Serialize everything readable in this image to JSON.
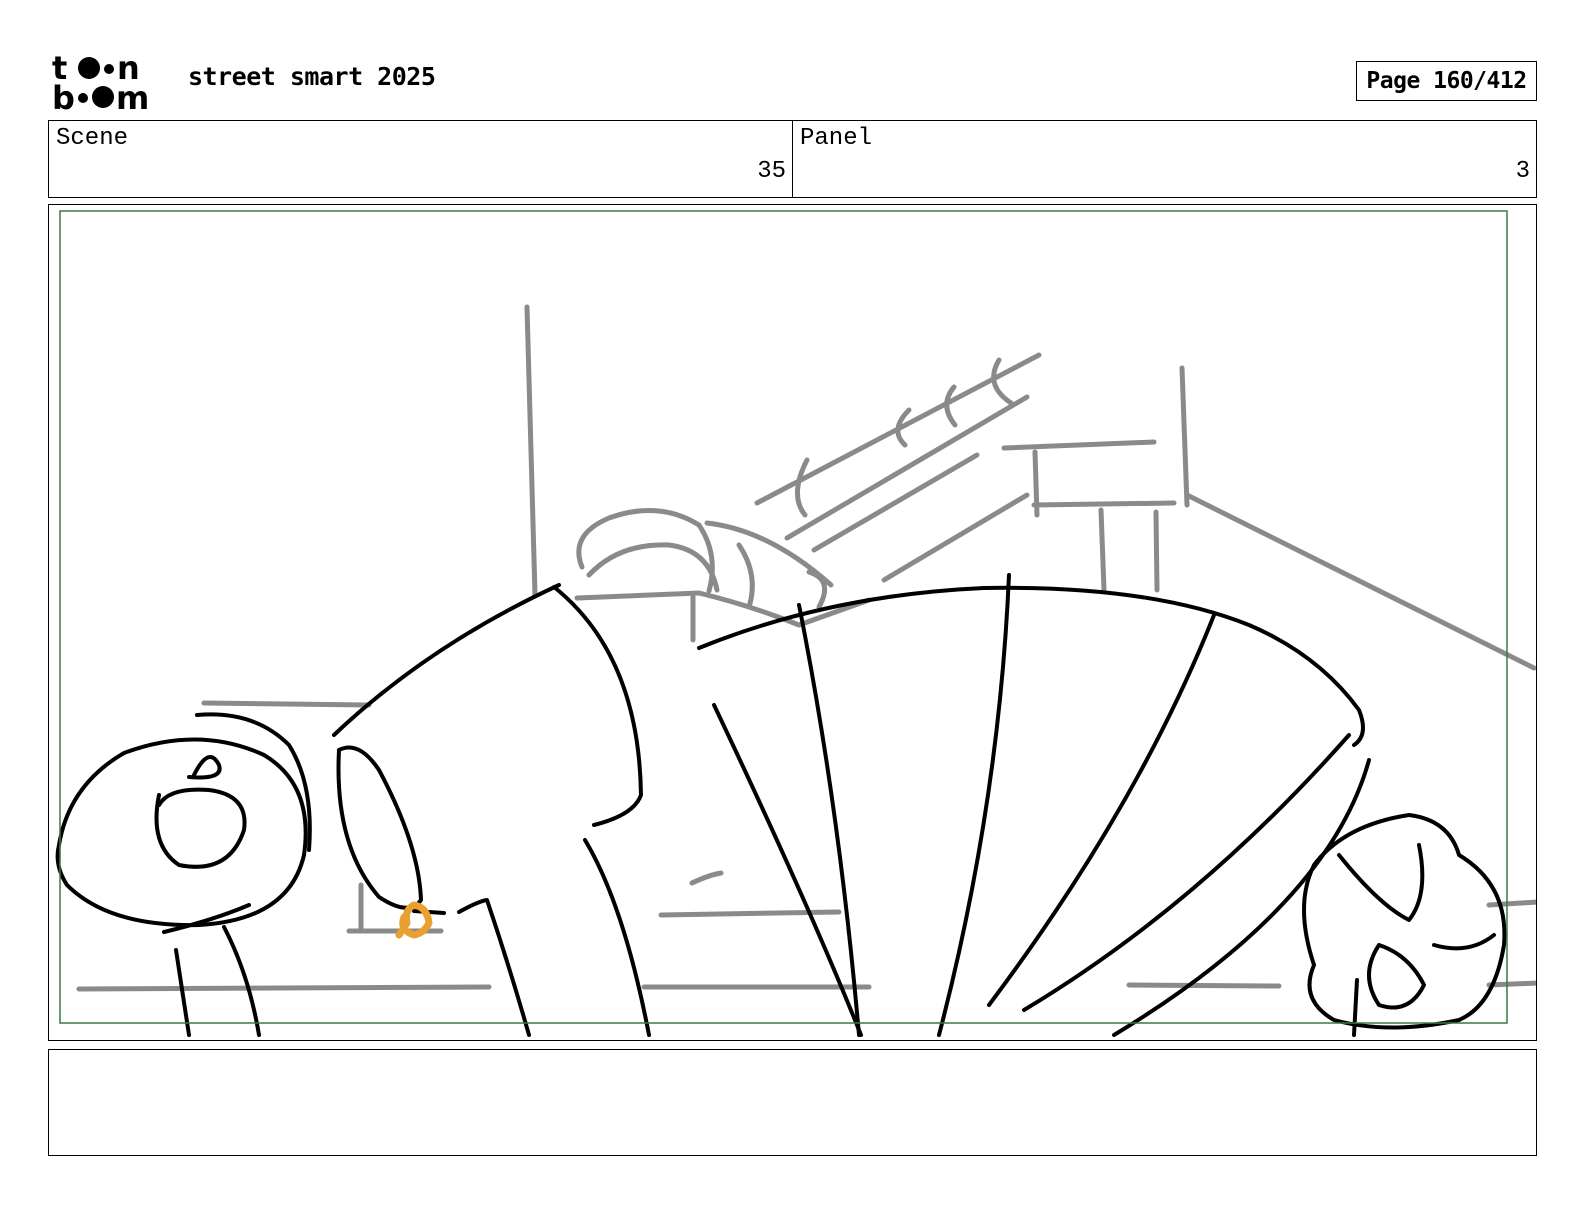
{
  "header": {
    "logo_text": [
      "t",
      "n",
      "b",
      "m"
    ],
    "project_title": "street smart 2025",
    "page_label": "Page 160/412"
  },
  "info": {
    "scene": {
      "label": "Scene",
      "value": "35"
    },
    "panel": {
      "label": "Panel",
      "value": "3"
    }
  },
  "notes": {
    "text": ""
  },
  "colors": {
    "safe_frame": "#3a7a3a",
    "sketch_gray": "#8a8a8a",
    "sketch_ink": "#000000",
    "accent_orange": "#e8a030"
  }
}
